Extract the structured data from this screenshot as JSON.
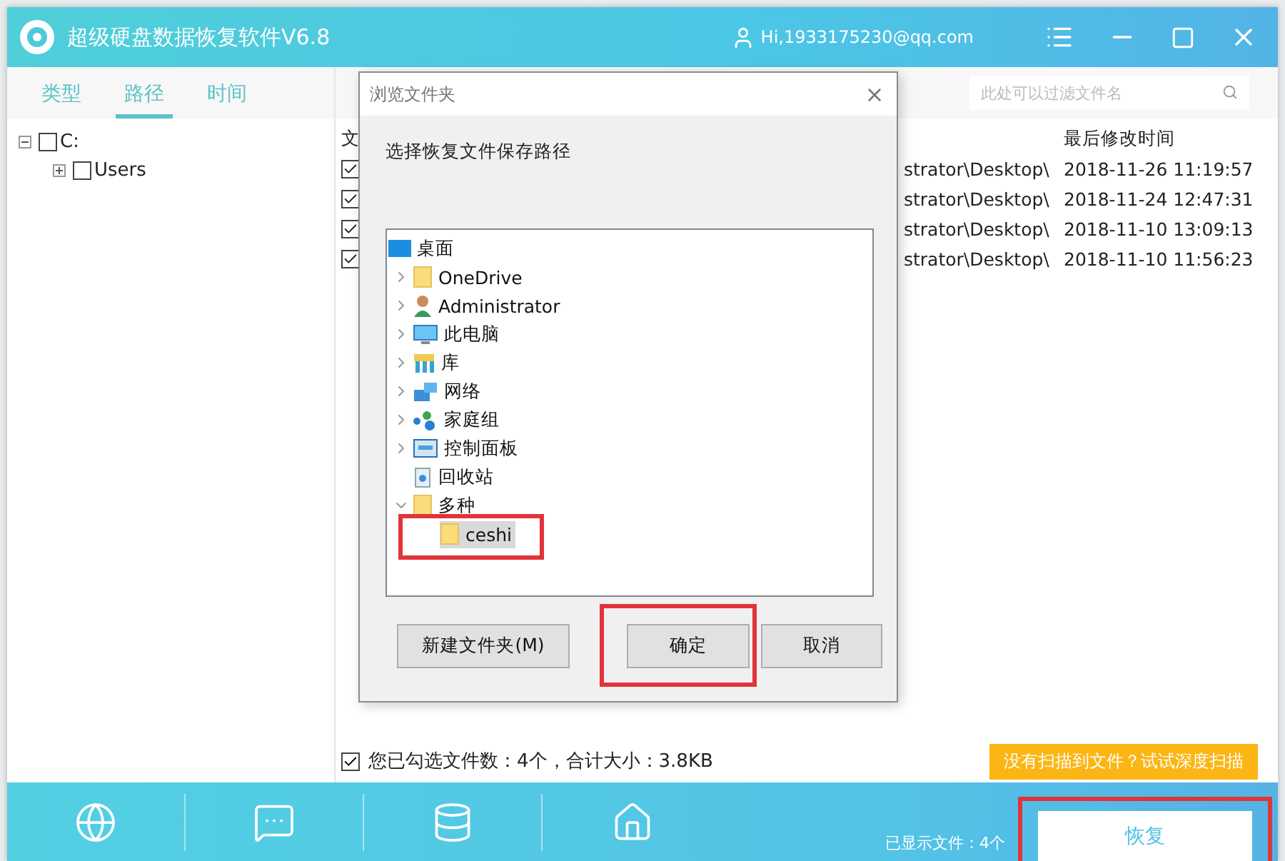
{
  "window": {
    "title": "超级硬盘数据恢复软件V6.8",
    "user": "Hi,1933175230@qq.com"
  },
  "tabs": [
    {
      "label": "类型",
      "selected": false
    },
    {
      "label": "路径",
      "selected": true
    },
    {
      "label": "时间",
      "selected": false
    }
  ],
  "drive_tree": [
    {
      "label": "C:",
      "checked": false,
      "expanded": true,
      "children": [
        {
          "label": "Users",
          "checked": false,
          "expanded": false
        }
      ]
    }
  ],
  "search": {
    "placeholder": "此处可以过滤文件名"
  },
  "table": {
    "columns": [
      {
        "label": "文"
      },
      {
        "label": "最后修改时间"
      }
    ],
    "rows": [
      {
        "checked": true,
        "path": "strator\\Desktop\\",
        "modified": "2018-11-26 11:19:57"
      },
      {
        "checked": true,
        "path": "strator\\Desktop\\",
        "modified": "2018-11-24 12:47:31"
      },
      {
        "checked": true,
        "path": "strator\\Desktop\\",
        "modified": "2018-11-10 13:09:13"
      },
      {
        "checked": true,
        "path": "strator\\Desktop\\",
        "modified": "2018-11-10 11:56:23"
      }
    ]
  },
  "selection_status": {
    "checked": true,
    "text": "您已勾选文件数：4个，合计大小：3.8KB"
  },
  "deep_scan_button": {
    "label": "没有扫描到文件？试试深度扫描"
  },
  "bottom_bar": {
    "tools": [
      {
        "kind": "globe"
      },
      {
        "kind": "chat"
      },
      {
        "kind": "database"
      },
      {
        "kind": "home"
      }
    ],
    "file_count": "已显示文件：4个",
    "recover_button": {
      "label": "恢复",
      "highlighted": true
    }
  },
  "dialog": {
    "title": "浏览文件夹",
    "instruction": "选择恢复文件保存路径",
    "tree": [
      {
        "label": "桌面",
        "kind": "desktop",
        "selected": false,
        "children": [
          {
            "label": "OneDrive",
            "kind": "folder",
            "expanded": false,
            "selected": false
          },
          {
            "label": "Administrator",
            "kind": "user",
            "expanded": false,
            "selected": false
          },
          {
            "label": "此电脑",
            "kind": "computer",
            "expanded": false,
            "selected": false
          },
          {
            "label": "库",
            "kind": "library",
            "expanded": false,
            "selected": false
          },
          {
            "label": "网络",
            "kind": "network",
            "expanded": false,
            "selected": false
          },
          {
            "label": "家庭组",
            "kind": "homegroup",
            "expanded": false,
            "selected": false
          },
          {
            "label": "控制面板",
            "kind": "panel",
            "expanded": false,
            "selected": false
          },
          {
            "label": "回收站",
            "kind": "bin",
            "selected": false
          },
          {
            "label": "多种",
            "kind": "folder",
            "expanded": true,
            "selected": false,
            "children": [
              {
                "label": "ceshi",
                "kind": "folder",
                "selected": true,
                "highlighted": true
              }
            ]
          }
        ]
      }
    ],
    "buttons": [
      {
        "label": "新建文件夹(M)"
      },
      {
        "label": "确定",
        "highlighted": true
      },
      {
        "label": "取消"
      }
    ]
  }
}
